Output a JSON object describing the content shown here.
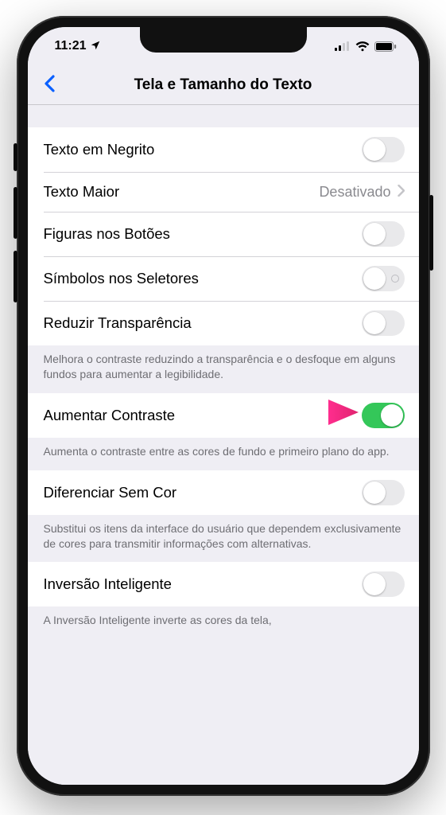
{
  "status": {
    "time": "11:21",
    "location_indicator": true
  },
  "nav": {
    "title": "Tela e Tamanho do Texto"
  },
  "rows": {
    "bold_text": "Texto em Negrito",
    "larger_text": "Texto Maior",
    "larger_text_value": "Desativado",
    "button_shapes": "Figuras nos Botões",
    "onoff_labels": "Símbolos nos Seletores",
    "reduce_transparency": "Reduzir Transparência",
    "increase_contrast": "Aumentar Contraste",
    "differentiate_without_color": "Diferenciar Sem Cor",
    "smart_invert": "Inversão Inteligente"
  },
  "footers": {
    "reduce_transparency": "Melhora o contraste reduzindo a transparência e o desfoque em alguns fundos para aumentar a legibilidade.",
    "increase_contrast": "Aumenta o contraste entre as cores de fundo e primeiro plano do app.",
    "differentiate_without_color": "Substitui os itens da interface do usuário que dependem exclusivamente de cores para transmitir informações com alternativas.",
    "smart_invert": "A Inversão Inteligente inverte as cores da tela,"
  },
  "toggle_states": {
    "bold_text": false,
    "button_shapes": false,
    "onoff_labels": false,
    "reduce_transparency": false,
    "increase_contrast": true,
    "differentiate_without_color": false,
    "smart_invert": false
  }
}
